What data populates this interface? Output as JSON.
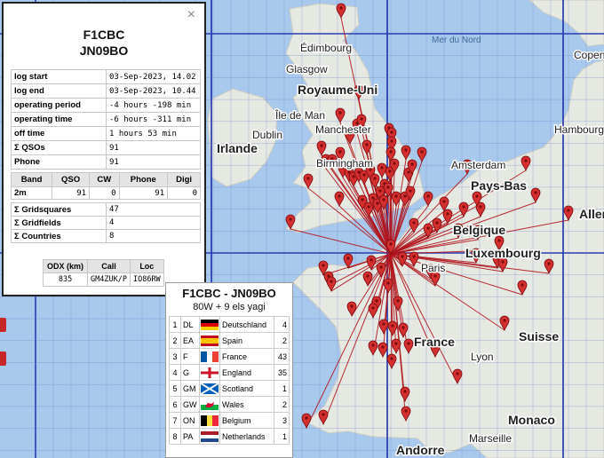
{
  "station": {
    "call": "F1CBC",
    "locator": "JN09BO"
  },
  "popup": {
    "close_glyph": "×",
    "info": [
      {
        "key": "log start",
        "value": "03-Sep-2023, 14.02"
      },
      {
        "key": "log end",
        "value": "03-Sep-2023, 10.44"
      },
      {
        "key": "operating period",
        "value": "-4 hours -198 min"
      },
      {
        "key": "operating time",
        "value": "-6 hours -311 min"
      },
      {
        "key": "off time",
        "value": "1 hours 53 min"
      },
      {
        "key": "Σ QSOs",
        "value": "91"
      },
      {
        "key": "Phone",
        "value": "91"
      }
    ],
    "band_headers": [
      "Band",
      "QSO",
      "CW",
      "Phone",
      "Digi"
    ],
    "band_rows": [
      {
        "band": "2m",
        "qso": "91",
        "cw": "0",
        "phone": "91",
        "digi": "0"
      }
    ],
    "summary": [
      {
        "key": "Σ Gridsquares",
        "value": "47"
      },
      {
        "key": "Σ Gridfields",
        "value": "4"
      },
      {
        "key": "Σ Countries",
        "value": "8"
      }
    ],
    "odx_headers": [
      "ODX (km)",
      "Call",
      "Loc"
    ],
    "odx": {
      "km": "835",
      "call": "GM4ZUK/P",
      "loc": "IO86RW"
    }
  },
  "card": {
    "title": "F1CBC - JN09BO",
    "subtitle": "80W + 9 els yagi",
    "countries": [
      {
        "n": "1",
        "prefix": "DL",
        "flag": "de",
        "name": "Deutschland",
        "count": "4"
      },
      {
        "n": "2",
        "prefix": "EA",
        "flag": "es",
        "name": "Spain",
        "count": "2"
      },
      {
        "n": "3",
        "prefix": "F",
        "flag": "fr",
        "name": "France",
        "count": "43"
      },
      {
        "n": "4",
        "prefix": "G",
        "flag": "en",
        "name": "England",
        "count": "35"
      },
      {
        "n": "5",
        "prefix": "GM",
        "flag": "sc",
        "name": "Scotland",
        "count": "1"
      },
      {
        "n": "6",
        "prefix": "GW",
        "flag": "wa",
        "name": "Wales",
        "count": "2"
      },
      {
        "n": "7",
        "prefix": "ON",
        "flag": "be",
        "name": "Belgium",
        "count": "3"
      },
      {
        "n": "8",
        "prefix": "PA",
        "flag": "nl",
        "name": "Netherlands",
        "count": "1"
      }
    ]
  },
  "map_labels": [
    {
      "id": "edimbourg",
      "text": "Édimbourg",
      "bold": false
    },
    {
      "id": "glasgow",
      "text": "Glasgow",
      "bold": false
    },
    {
      "id": "royaume-uni",
      "text": "Royaume-Uni",
      "bold": true
    },
    {
      "id": "ile-de-man",
      "text": "Île de Man",
      "bold": false
    },
    {
      "id": "dublin",
      "text": "Dublin",
      "bold": false
    },
    {
      "id": "irlande",
      "text": "Irlande",
      "bold": true
    },
    {
      "id": "manchester",
      "text": "Manchester",
      "bold": false
    },
    {
      "id": "birmingham",
      "text": "Birmingham",
      "bold": false
    },
    {
      "id": "amsterdam",
      "text": "Amsterdam",
      "bold": false
    },
    {
      "id": "pays-bas",
      "text": "Pays-Bas",
      "bold": true
    },
    {
      "id": "hambourg",
      "text": "Hambourg",
      "bold": false
    },
    {
      "id": "copenhague",
      "text": "Copenhague",
      "bold": false
    },
    {
      "id": "allemagne",
      "text": "Allemag",
      "bold": true
    },
    {
      "id": "belgique",
      "text": "Belgique",
      "bold": true
    },
    {
      "id": "luxembourg",
      "text": "Luxembourg",
      "bold": true
    },
    {
      "id": "paris",
      "text": "Paris",
      "bold": false
    },
    {
      "id": "france",
      "text": "France",
      "bold": true
    },
    {
      "id": "suisse",
      "text": "Suisse",
      "bold": true
    },
    {
      "id": "lyon",
      "text": "Lyon",
      "bold": false
    },
    {
      "id": "monaco",
      "text": "Monaco",
      "bold": true
    },
    {
      "id": "marseille",
      "text": "Marseille",
      "bold": false
    },
    {
      "id": "andorre",
      "text": "Andorre",
      "bold": true
    }
  ],
  "sea_labels": [
    {
      "id": "mer-du-nord",
      "text": "Mer du Nord"
    }
  ],
  "colors": {
    "land": "#e6e9e2",
    "sea": "#a9c9ec",
    "grid": "#1a2fa8",
    "path": "#b0151d",
    "marker": "#d32f2f"
  }
}
